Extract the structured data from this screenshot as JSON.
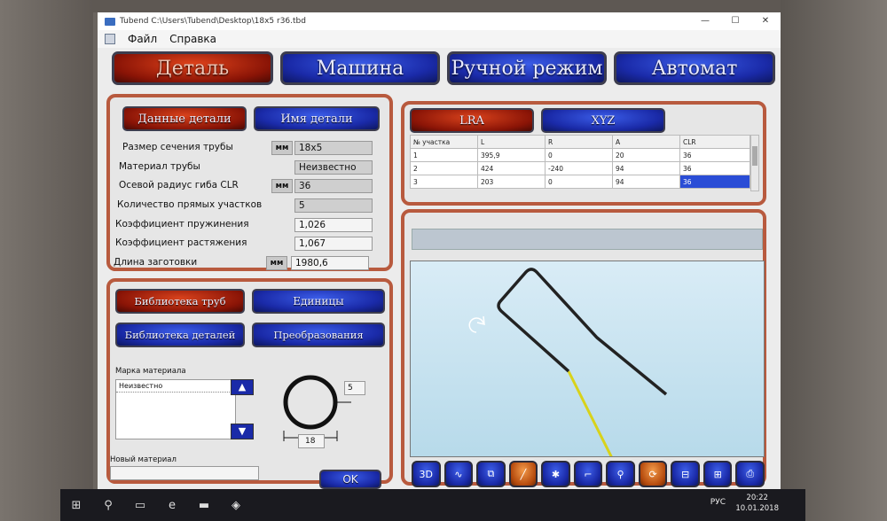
{
  "window": {
    "title": "Tubend C:\\Users\\Tubend\\Desktop\\18x5 r36.tbd"
  },
  "menu": {
    "file": "Файл",
    "help": "Справка"
  },
  "main_tabs": {
    "detail": "Деталь",
    "machine": "Машина",
    "manual": "Ручной режим",
    "auto": "Автомат"
  },
  "part_panel": {
    "tab_data": "Данные детали",
    "tab_name": "Имя детали",
    "unit": "мм",
    "rows": [
      {
        "label": "Размер сечения трубы",
        "value": "18x5"
      },
      {
        "label": "Материал трубы",
        "value": "Неизвестно"
      },
      {
        "label": "Осевой радиус гиба CLR",
        "value": "36"
      },
      {
        "label": "Количество прямых участков",
        "value": "5"
      },
      {
        "label": "Коэффициент пружинения",
        "value": "1,026"
      },
      {
        "label": "Коэффициент растяжения",
        "value": "1,067"
      },
      {
        "label": "Длина заготовки",
        "value": "1980,6"
      }
    ]
  },
  "lib_panel": {
    "tube_lib": "Библиотека труб",
    "units": "Единицы",
    "part_lib": "Библиотека деталей",
    "transform": "Преобразования",
    "material_label": "Марка материала",
    "material_item": "Неизвестно",
    "new_material_label": "Новый материал",
    "ok": "OK",
    "wall": "5",
    "diameter": "18"
  },
  "coord_panel": {
    "tab_lra": "LRA",
    "tab_xyz": "XYZ",
    "headers": [
      "№ участка",
      "L",
      "R",
      "A",
      "CLR"
    ],
    "rows": [
      [
        "1",
        "395,9",
        "0",
        "20",
        "36"
      ],
      [
        "2",
        "424",
        "-240",
        "94",
        "36"
      ],
      [
        "3",
        "203",
        "0",
        "94",
        "36"
      ]
    ]
  },
  "toolbar": {
    "btn_3d": "3D"
  },
  "taskbar": {
    "lang": "РУС",
    "time": "20:22",
    "date": "10.01.2018"
  }
}
